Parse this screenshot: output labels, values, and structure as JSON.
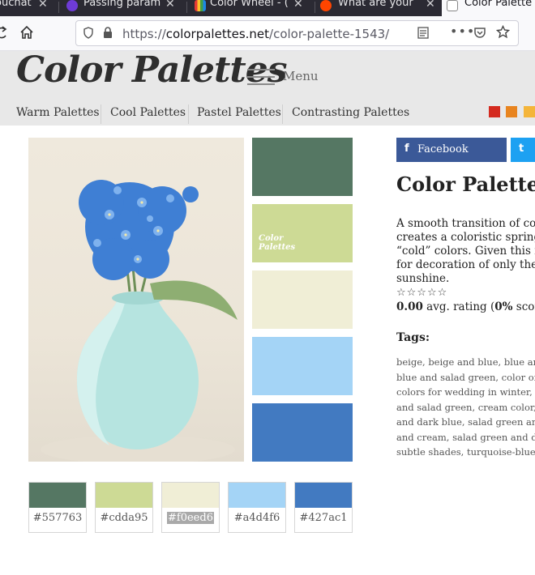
{
  "browser": {
    "tabs": [
      {
        "title": "ouchat",
        "close": "✕"
      },
      {
        "title": "Passing param",
        "close": "✕"
      },
      {
        "title": "Color Wheel - (",
        "close": "✕"
      },
      {
        "title": "What are your",
        "close": "✕"
      },
      {
        "title": "Color Palette",
        "close": ""
      }
    ],
    "url_prefix": "https://",
    "url_domain": "colorpalettes.net",
    "url_path": "/color-palette-1543/"
  },
  "site": {
    "logo": "Color Palettes",
    "menu_label": "Menu",
    "nav": [
      "Warm Palettes",
      "Cool Palettes",
      "Pastel Palettes",
      "Contrasting Palettes"
    ],
    "nav_squares": [
      "#d42a1f",
      "#e8841f",
      "#f4b53a"
    ]
  },
  "palette": {
    "swatch_watermark": [
      "Color",
      "Palettes"
    ],
    "colors": [
      {
        "hex": "#557763",
        "label": "#557763"
      },
      {
        "hex": "#cdda95",
        "label": "#cdda95"
      },
      {
        "hex": "#f0eed6",
        "label": "#f0eed6"
      },
      {
        "hex": "#a4d4f6",
        "label": "#a4d4f6"
      },
      {
        "hex": "#427ac1",
        "label": "#427ac1"
      }
    ]
  },
  "sidebar": {
    "facebook_icon": "f",
    "facebook_label": "Facebook",
    "twitter_icon": "t",
    "title": "Color Palette",
    "description_lines": [
      "A smooth transition of colo",
      "creates a coloristic spring",
      "“cold” colors. Given this fe",
      "for decoration of only the",
      "sunshine."
    ],
    "stars": "☆☆☆☆☆",
    "rating_value": "0.00",
    "rating_text": " avg. rating (",
    "rating_pct": "0%",
    "rating_tail": " score",
    "tags_heading": "Tags:",
    "tags_lines": [
      "beige, beige and blue, blue and",
      "blue and salad green, color of c",
      "colors for wedding in winter, c",
      "and salad green, cream color,",
      "and dark blue, salad green and",
      "and cream, salad green and de",
      "subtle shades, turquoise-blue."
    ]
  }
}
